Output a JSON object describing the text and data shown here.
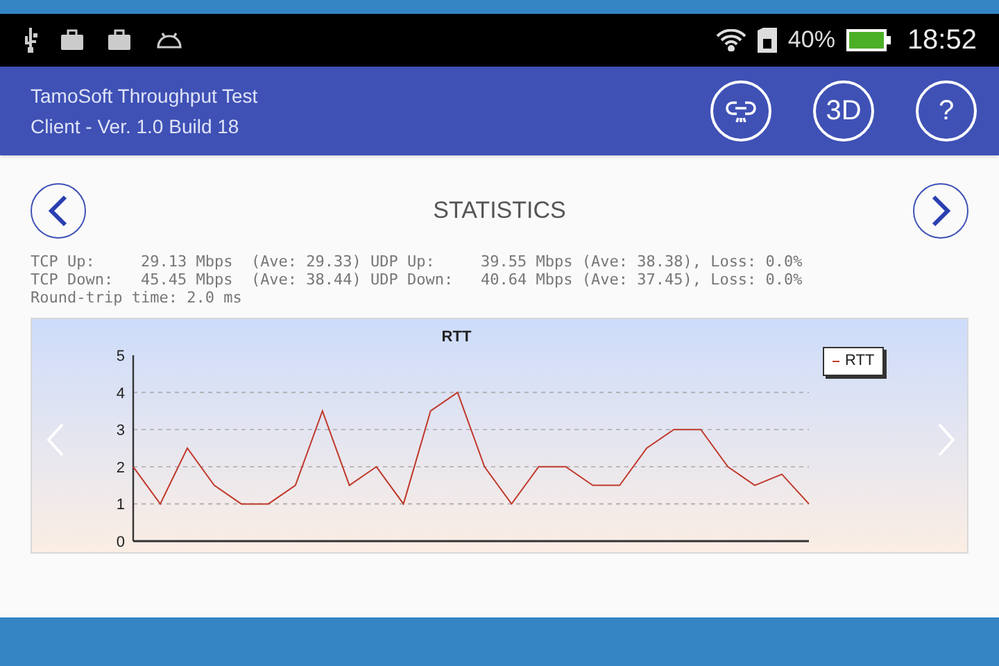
{
  "status_bar": {
    "battery_percent": "40%",
    "time": "18:52"
  },
  "app_bar": {
    "title": "TamoSoft Throughput Test",
    "subtitle": "Client - Ver. 1.0 Build 18",
    "buttons": [
      {
        "kind": "link"
      },
      {
        "kind": "text",
        "label": "3D"
      },
      {
        "kind": "text",
        "label": "?"
      }
    ]
  },
  "page": {
    "title": "STATISTICS"
  },
  "stats": [
    "TCP Up:     29.13 Mbps  (Ave: 29.33) UDP Up:     39.55 Mbps (Ave: 38.38), Loss: 0.0%",
    "TCP Down:   45.45 Mbps  (Ave: 38.44) UDP Down:   40.64 Mbps (Ave: 37.45), Loss: 0.0%",
    "Round-trip time: 2.0 ms"
  ],
  "chart": {
    "chart_data": {
      "type": "line",
      "title": "RTT",
      "ylim": [
        0,
        5
      ],
      "grid": true,
      "yticks": [
        0,
        1,
        2,
        3,
        4,
        5
      ],
      "series": [
        {
          "name": "RTT",
          "color": "#c0392b",
          "values": [
            2,
            1,
            2.5,
            1.5,
            1,
            1,
            1.5,
            3.5,
            1.5,
            2,
            1,
            3.5,
            4,
            2,
            1,
            2,
            2,
            1.5,
            1.5,
            2.5,
            3,
            3,
            2,
            1.5,
            1.8,
            1
          ]
        }
      ]
    }
  }
}
